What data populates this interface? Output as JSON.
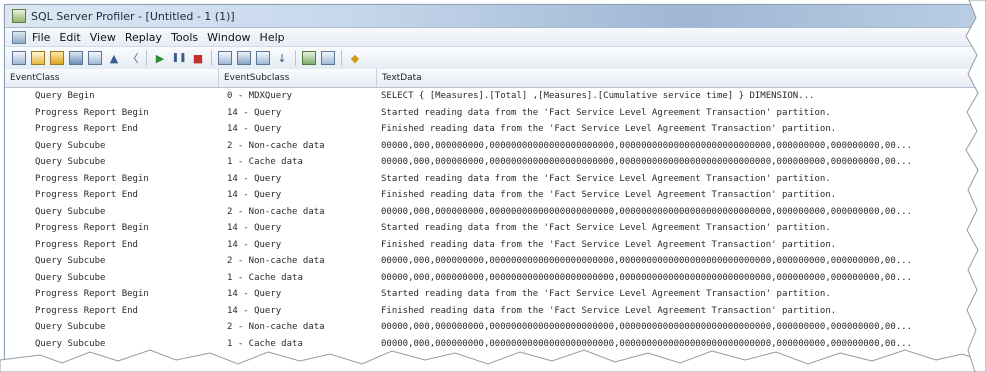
{
  "window": {
    "title": "SQL Server Profiler - [Untitled - 1 (1)]"
  },
  "menu": {
    "items": [
      "File",
      "Edit",
      "View",
      "Replay",
      "Tools",
      "Window",
      "Help"
    ]
  },
  "toolbar": {
    "icons": [
      "new-trace-icon",
      "new-template-icon",
      "open-icon",
      "save-icon",
      "properties-icon",
      "find-icon",
      "clear-icon",
      "run-icon",
      "pause-icon",
      "stop-icon",
      "template-icon",
      "columns-icon",
      "filter-icon",
      "scroll-icon",
      "performance-icon",
      "activity-icon",
      "help-icon"
    ]
  },
  "grid": {
    "columns": [
      "EventClass",
      "EventSubclass",
      "TextData"
    ],
    "rows": [
      {
        "event_class": "Query Begin",
        "event_subclass": "0 - MDXQuery",
        "text_data": "SELECT    {     [Measures].[Total]      ,[Measures].[Cumulative service time]    }    DIMENSION..."
      },
      {
        "event_class": "Progress Report Begin",
        "event_subclass": "14 - Query",
        "text_data": "Started reading data from the 'Fact Service Level Agreement Transaction' partition."
      },
      {
        "event_class": "Progress Report End",
        "event_subclass": "14 - Query",
        "text_data": "Finished reading data from the 'Fact Service Level Agreement Transaction' partition."
      },
      {
        "event_class": "Query Subcube",
        "event_subclass": "2 - Non-cache data",
        "text_data": "00000,000,000000000,00000000000000000000000,0000000000000000000000000000,000000000,000000000,00..."
      },
      {
        "event_class": "Query Subcube",
        "event_subclass": "1 - Cache data",
        "text_data": "00000,000,000000000,00000000000000000000000,0000000000000000000000000000,000000000,000000000,00..."
      },
      {
        "event_class": "Progress Report Begin",
        "event_subclass": "14 - Query",
        "text_data": "Started reading data from the 'Fact Service Level Agreement Transaction' partition."
      },
      {
        "event_class": "Progress Report End",
        "event_subclass": "14 - Query",
        "text_data": "Finished reading data from the 'Fact Service Level Agreement Transaction' partition."
      },
      {
        "event_class": "Query Subcube",
        "event_subclass": "2 - Non-cache data",
        "text_data": "00000,000,000000000,00000000000000000000000,0000000000000000000000000000,000000000,000000000,00..."
      },
      {
        "event_class": "Progress Report Begin",
        "event_subclass": "14 - Query",
        "text_data": "Started reading data from the 'Fact Service Level Agreement Transaction' partition."
      },
      {
        "event_class": "Progress Report End",
        "event_subclass": "14 - Query",
        "text_data": "Finished reading data from the 'Fact Service Level Agreement Transaction' partition."
      },
      {
        "event_class": "Query Subcube",
        "event_subclass": "2 - Non-cache data",
        "text_data": "00000,000,000000000,00000000000000000000000,0000000000000000000000000000,000000000,000000000,00..."
      },
      {
        "event_class": "Query Subcube",
        "event_subclass": "1 - Cache data",
        "text_data": "00000,000,000000000,00000000000000000000000,0000000000000000000000000000,000000000,000000000,00..."
      },
      {
        "event_class": "Progress Report Begin",
        "event_subclass": "14 - Query",
        "text_data": "Started reading data from the 'Fact Service Level Agreement Transaction' partition."
      },
      {
        "event_class": "Progress Report End",
        "event_subclass": "14 - Query",
        "text_data": "Finished reading data from the 'Fact Service Level Agreement Transaction' partition."
      },
      {
        "event_class": "Query Subcube",
        "event_subclass": "2 - Non-cache data",
        "text_data": "00000,000,000000000,00000000000000000000000,0000000000000000000000000000,000000000,000000000,00..."
      },
      {
        "event_class": "Query Subcube",
        "event_subclass": "1 - Cache data",
        "text_data": "00000,000,000000000,00000000000000000000000,0000000000000000000000000000,000000000,000000000,00..."
      }
    ]
  }
}
